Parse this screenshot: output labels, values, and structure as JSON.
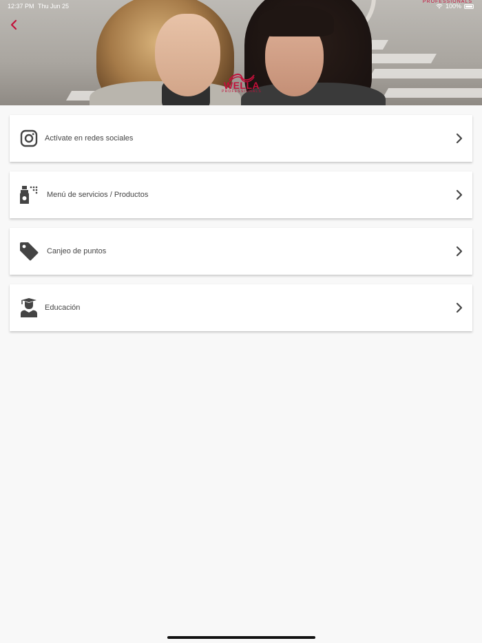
{
  "status_bar": {
    "time": "12:37 PM",
    "date": "Thu Jun 25",
    "battery": "100%"
  },
  "header": {
    "brand_top": "PROFESSIONALS",
    "logo_word": "WELLA",
    "logo_sub": "PROFESSIONALS"
  },
  "menu": {
    "items": [
      {
        "label": "Actívate en redes sociales",
        "icon": "instagram-icon"
      },
      {
        "label": "Menú de servicios / Productos",
        "icon": "spray-bottle-icon"
      },
      {
        "label": "Canjeo de puntos",
        "icon": "tag-icon"
      },
      {
        "label": "Educación",
        "icon": "graduate-icon"
      }
    ]
  },
  "colors": {
    "accent": "#c2103a",
    "icon": "#444444",
    "background": "#f8f8f8"
  }
}
